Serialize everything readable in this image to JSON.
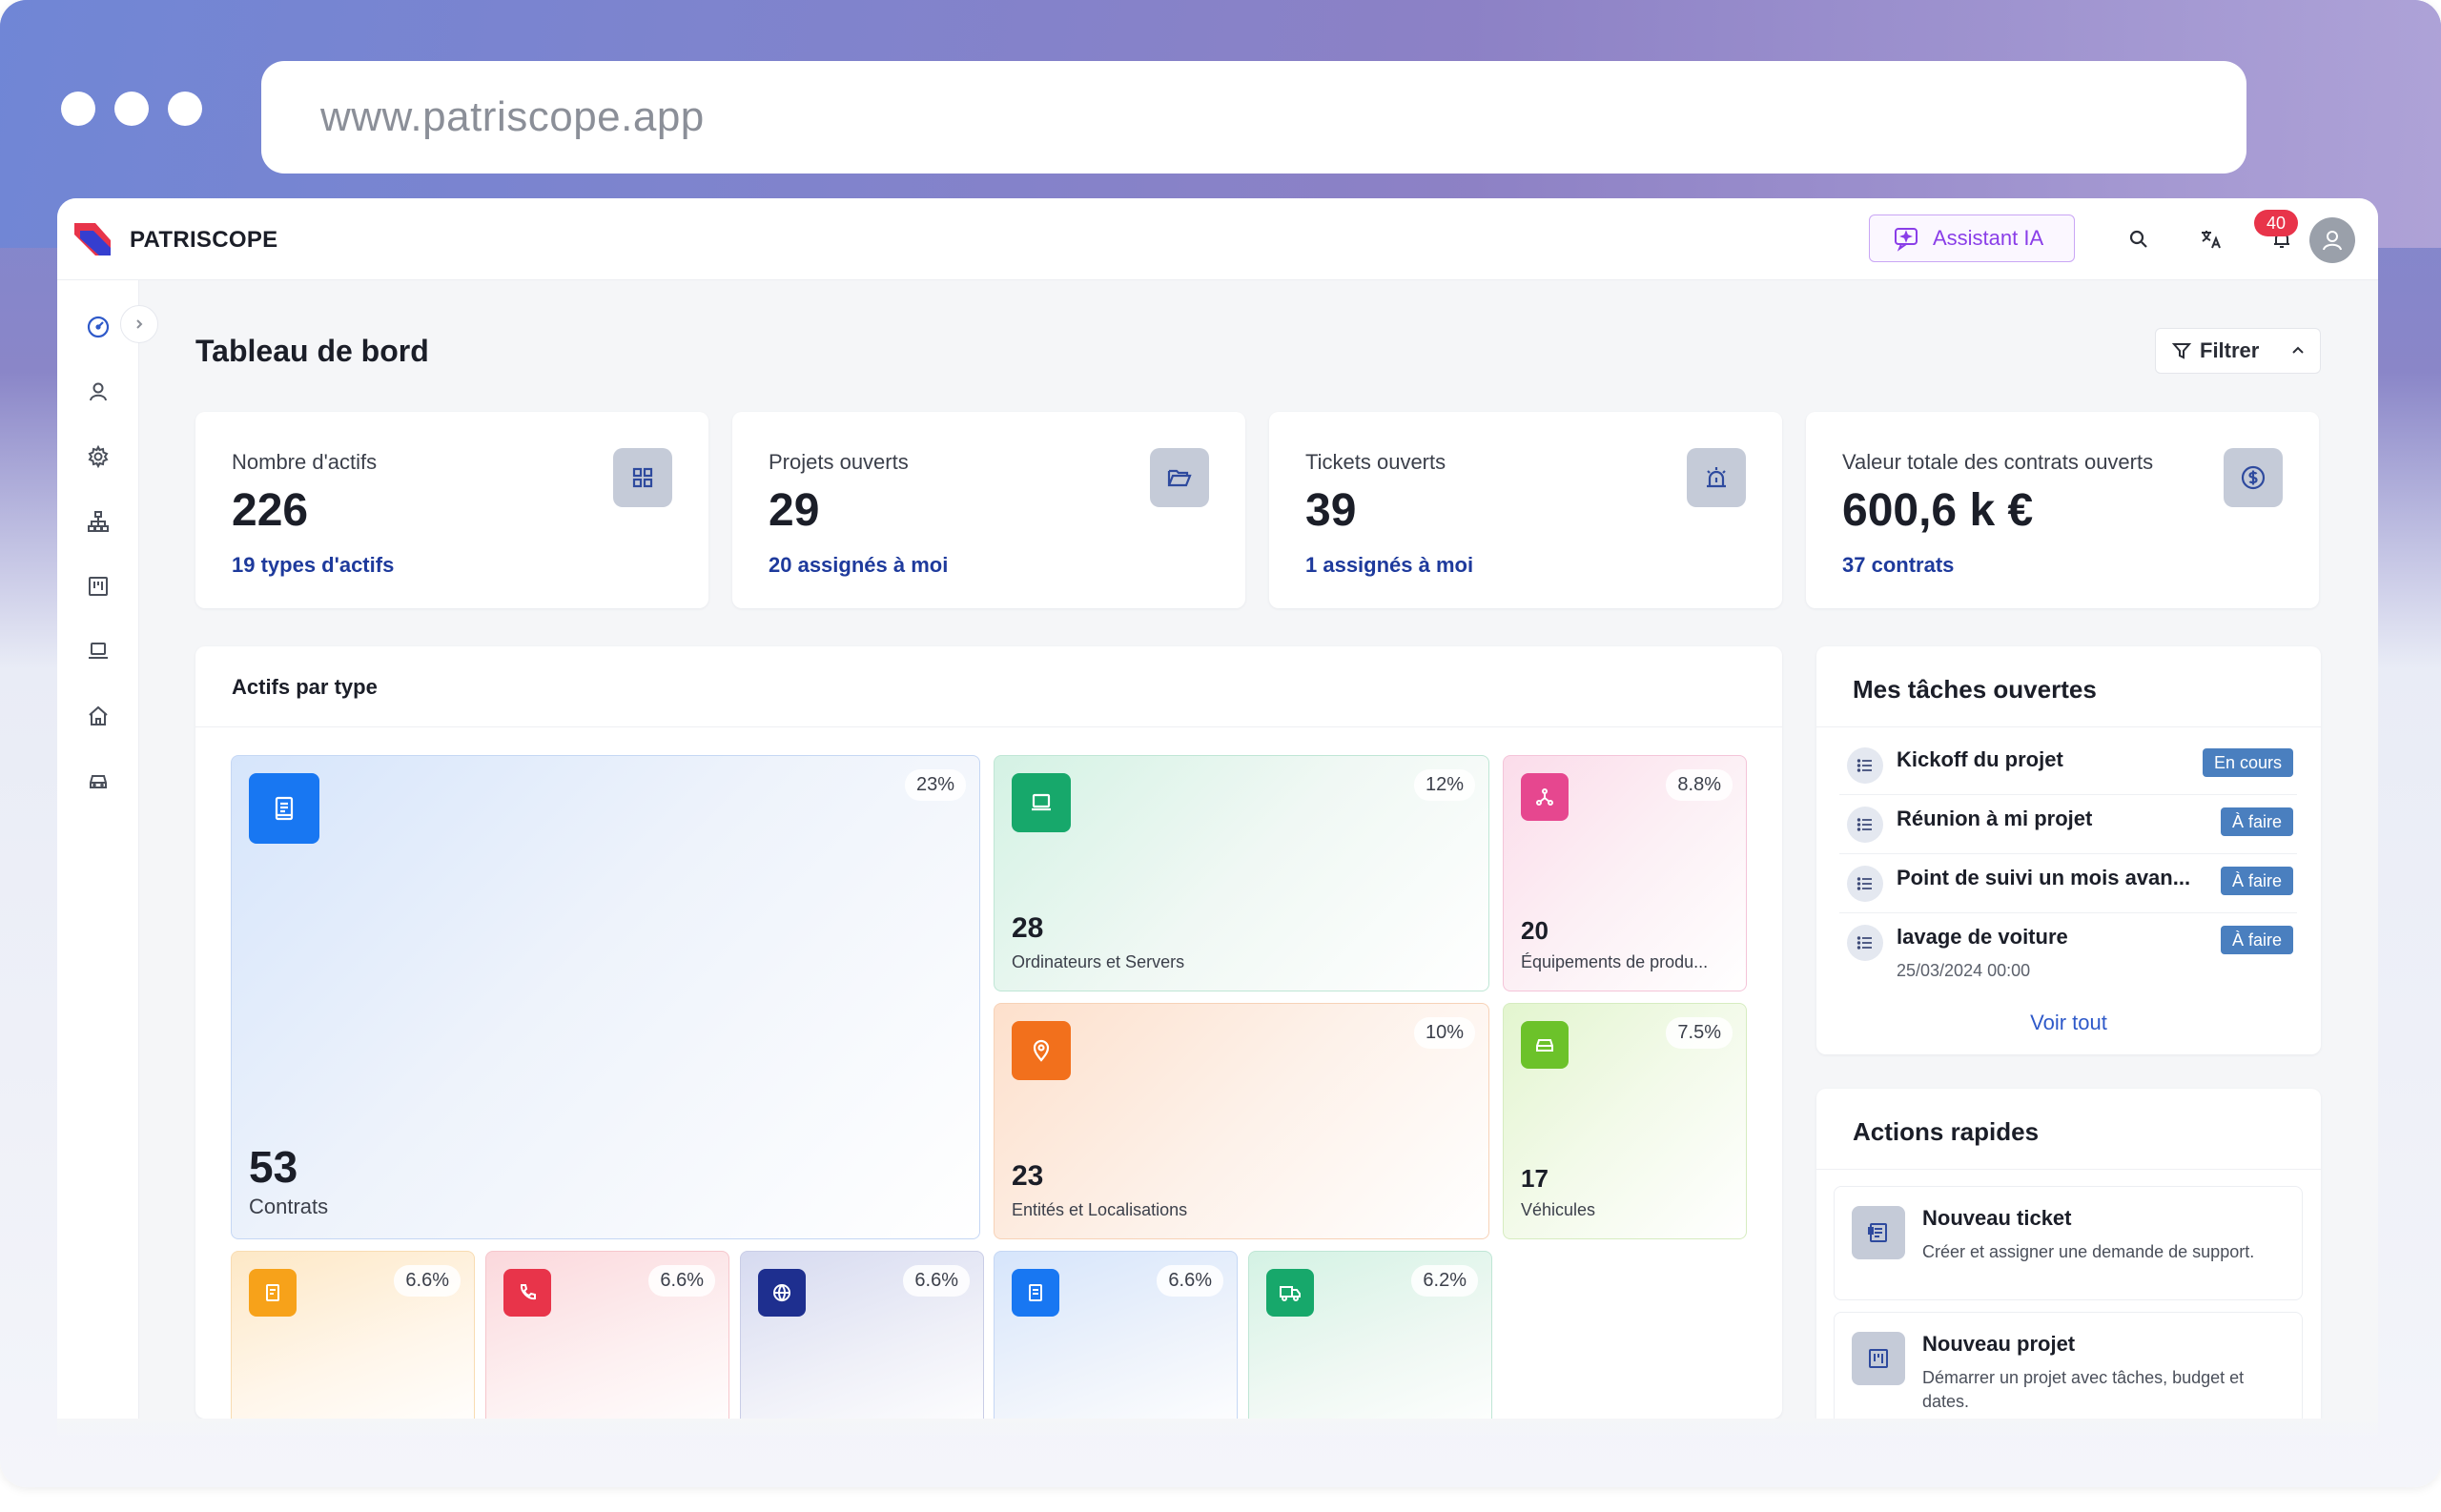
{
  "browser": {
    "url": "www.patriscope.app"
  },
  "header": {
    "brand": "PATRISCOPE",
    "assistant_label": "Assistant IA",
    "notification_count": "40"
  },
  "page": {
    "title": "Tableau de bord",
    "filter_label": "Filtrer"
  },
  "stats": [
    {
      "label": "Nombre d'actifs",
      "value": "226",
      "link": "19 types d'actifs",
      "icon": "grid-icon"
    },
    {
      "label": "Projets ouverts",
      "value": "29",
      "link": "20 assignés à moi",
      "icon": "folder-open-icon"
    },
    {
      "label": "Tickets ouverts",
      "value": "39",
      "link": "1 assignés à moi",
      "icon": "alarm-icon"
    },
    {
      "label": "Valeur totale des contrats ouverts",
      "value": "600,6 k €",
      "link": "37 contrats",
      "icon": "dollar-circle-icon"
    }
  ],
  "asset_types": {
    "title": "Actifs par type",
    "tiles": [
      {
        "count": "53",
        "name": "Contrats",
        "pct": "23%",
        "icon": "document-icon",
        "color": "#1877f2"
      },
      {
        "count": "28",
        "name": "Ordinateurs et Servers",
        "pct": "12%",
        "icon": "laptop-icon",
        "color": "#17a86b"
      },
      {
        "count": "20",
        "name": "Équipements de produ...",
        "pct": "8.8%",
        "icon": "network-icon",
        "color": "#e6478f"
      },
      {
        "count": "23",
        "name": "Entités et Localisations",
        "pct": "10%",
        "icon": "map-pin-icon",
        "color": "#f2701c"
      },
      {
        "count": "17",
        "name": "Véhicules",
        "pct": "7.5%",
        "icon": "car-icon",
        "color": "#6cc22a"
      },
      {
        "pct": "6.6%",
        "icon": "receipt-icon",
        "color": "#f7a21a"
      },
      {
        "pct": "6.6%",
        "icon": "phone-icon",
        "color": "#e8344a"
      },
      {
        "pct": "6.6%",
        "icon": "globe-icon",
        "color": "#1e2f8f"
      },
      {
        "pct": "6.6%",
        "icon": "file-icon",
        "color": "#1877f2"
      },
      {
        "pct": "6.2%",
        "icon": "truck-icon",
        "color": "#17a86b"
      }
    ]
  },
  "tasks": {
    "title": "Mes tâches ouvertes",
    "items": [
      {
        "name": "Kickoff du projet",
        "status": "En cours"
      },
      {
        "name": "Réunion à mi projet",
        "status": "À faire"
      },
      {
        "name": "Point de suivi un mois avan...",
        "status": "À faire"
      },
      {
        "name": "lavage de voiture",
        "status": "À faire",
        "date": "25/03/2024 00:00"
      }
    ],
    "see_all": "Voir tout"
  },
  "quick_actions": {
    "title": "Actions rapides",
    "items": [
      {
        "title": "Nouveau ticket",
        "desc": "Créer et assigner une demande de support.",
        "icon": "ticket-icon"
      },
      {
        "title": "Nouveau projet",
        "desc": "Démarrer un projet avec tâches, budget et dates.",
        "icon": "kanban-icon"
      }
    ]
  },
  "colors": {
    "link": "#1e3a9c",
    "assistant_accent": "#8a3ee8",
    "notification_badge": "#e8344a",
    "status_badge": "#4a7fbf"
  }
}
